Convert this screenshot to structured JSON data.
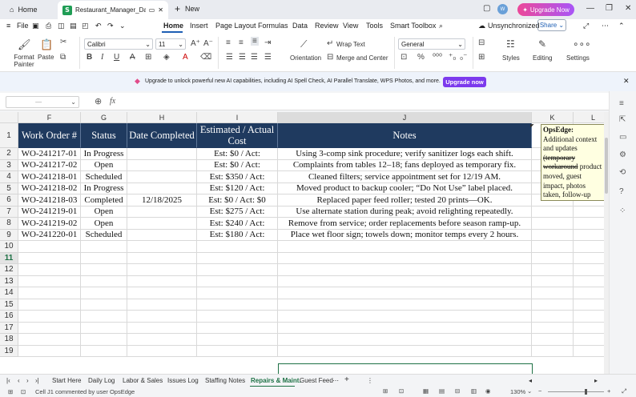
{
  "titlebar": {
    "home_tab": "Home",
    "doc_tab": "Restaurant_Manager_Daily_",
    "new_tab": "New",
    "avatar_initials": "W",
    "upgrade_label": "Upgrade Now"
  },
  "menubar": {
    "file": "File",
    "items": [
      "Home",
      "Insert",
      "Page Layout",
      "Formulas",
      "Data",
      "Review",
      "View",
      "Tools",
      "Smart Toolbox"
    ],
    "sync_status": "Unsynchronized",
    "share": "Share"
  },
  "ribbon": {
    "format_painter": "Format Painter",
    "paste": "Paste",
    "font_name": "Calibri",
    "font_size": "11",
    "wrap_text": "Wrap Text",
    "merge_center": "Merge and Center",
    "orientation": "Orientation",
    "number_format": "General",
    "styles": "Styles",
    "editing": "Editing",
    "settings": "Settings"
  },
  "banner": {
    "text": "Upgrade to unlock powerful new AI capabilities, including AI Spell Check, AI Parallel Translate, WPS Photos, and more.",
    "button": "Upgrade now"
  },
  "formula": {
    "fx": "fx",
    "content": ""
  },
  "sheet": {
    "columns": [
      "F",
      "G",
      "H",
      "I",
      "J",
      "K",
      "L"
    ],
    "selected_column": "J",
    "rows": [
      "1",
      "2",
      "3",
      "4",
      "5",
      "6",
      "7",
      "8",
      "9",
      "10",
      "11",
      "12",
      "13",
      "14",
      "15",
      "16",
      "17",
      "18",
      "19"
    ],
    "selected_row": "11",
    "headers": [
      "Work Order #",
      "Status",
      "Date Completed",
      "Estimated / Actual Cost",
      "Notes"
    ],
    "data": [
      [
        "WO-241217-01",
        "In Progress",
        "",
        "Est: $0 / Act:",
        "Using 3-comp sink procedure; verify sanitizer logs each shift."
      ],
      [
        "WO-241217-02",
        "Open",
        "",
        "Est: $0 / Act:",
        "Complaints from tables 12–18; fans deployed as temporary fix."
      ],
      [
        "WO-241218-01",
        "Scheduled",
        "",
        "Est: $350 / Act:",
        "Cleaned filters; service appointment set for 12/19 AM."
      ],
      [
        "WO-241218-02",
        "In Progress",
        "",
        "Est: $120 / Act:",
        "Moved product to backup cooler; “Do Not Use” label placed."
      ],
      [
        "WO-241218-03",
        "Completed",
        "12/18/2025",
        "Est: $0 / Act: $0",
        "Replaced paper feed roller; tested 20 prints—OK."
      ],
      [
        "WO-241219-01",
        "Open",
        "",
        "Est: $275 / Act:",
        "Use alternate station during peak; avoid relighting repeatedly."
      ],
      [
        "WO-241219-02",
        "Open",
        "",
        "Est: $240 / Act:",
        "Remove from service; order replacements before season ramp-up."
      ],
      [
        "WO-241220-01",
        "Scheduled",
        "",
        "Est: $180 / Act:",
        "Place wet floor sign; towels down; monitor temps every 2 hours."
      ]
    ],
    "comment": {
      "author": "OpsEdge:",
      "line1": "Additional context and updates",
      "struck": "(temporary workaround",
      "rest": "product moved, guest impact, photos taken, follow-up calls, warranty info, verification results"
    }
  },
  "tabs": [
    "Start Here",
    "Daily Log",
    "Labor & Sales",
    "Issues Log",
    "Staffing Notes",
    "Repairs & Maint.",
    "Guest Feed"
  ],
  "active_tab": "Repairs & Maint.",
  "status": {
    "text": "Cell J1 commented by user OpsEdge",
    "zoom": "130%"
  }
}
